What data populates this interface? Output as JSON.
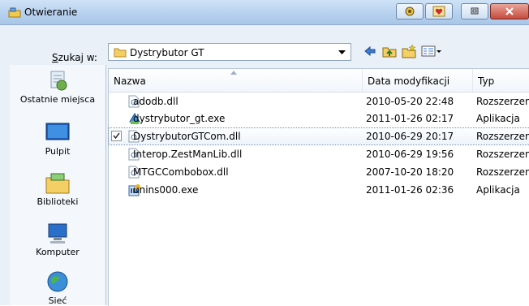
{
  "window": {
    "title": "Otwieranie",
    "accent": "#b9d3ef"
  },
  "toolbar": {
    "look_in_label_prefix": "S",
    "look_in_label_rest": "zukaj w:",
    "look_in_value": "Dystrybutor GT"
  },
  "places": [
    {
      "label": "Ostatnie miejsca",
      "icon": "recent-places-icon"
    },
    {
      "label": "Pulpit",
      "icon": "desktop-icon"
    },
    {
      "label": "Biblioteki",
      "icon": "libraries-icon"
    },
    {
      "label": "Komputer",
      "icon": "computer-icon"
    },
    {
      "label": "Sieć",
      "icon": "network-icon"
    }
  ],
  "columns": {
    "name": "Nazwa",
    "date": "Data modyfikacji",
    "type": "Typ"
  },
  "files": [
    {
      "name": "adodb.dll",
      "date": "2010-05-20 22:48",
      "type": "Rozszerzenie aplikacji",
      "icon": "dll-icon"
    },
    {
      "name": "dystrybutor_gt.exe",
      "date": "2011-01-26 02:17",
      "type": "Aplikacja",
      "icon": "app-icon"
    },
    {
      "name": "DystrybutorGTCom.dll",
      "date": "2010-06-29 20:17",
      "type": "Rozszerzenie aplikacji",
      "icon": "dll-icon",
      "selected": true
    },
    {
      "name": "Interop.ZestManLib.dll",
      "date": "2010-06-29 19:56",
      "type": "Rozszerzenie aplikacji",
      "icon": "dll-icon"
    },
    {
      "name": "MTGCCombobox.dll",
      "date": "2007-10-20 18:20",
      "type": "Rozszerzenie aplikacji",
      "icon": "dll-icon"
    },
    {
      "name": "unins000.exe",
      "date": "2011-01-26 02:36",
      "type": "Aplikacja",
      "icon": "installer-icon"
    }
  ]
}
